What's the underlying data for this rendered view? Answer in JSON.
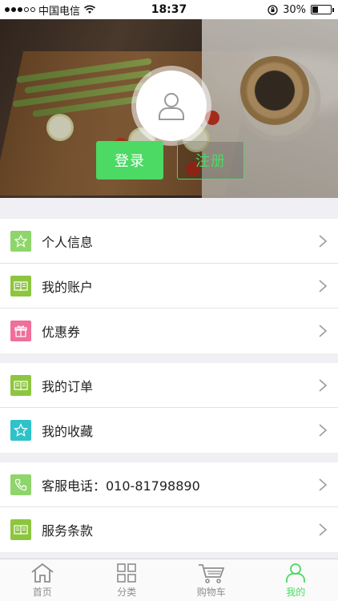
{
  "status_bar": {
    "carrier": "中国电信",
    "time": "18:37",
    "battery": "30%",
    "battery_level": 0.3
  },
  "header": {
    "login_label": "登录",
    "register_label": "注册"
  },
  "menu_groups": [
    {
      "items": [
        {
          "label": "个人信息",
          "icon": "profile-badge-icon",
          "color": "#8ed66b"
        },
        {
          "label": "我的账户",
          "icon": "book-icon",
          "color": "#8cc63f"
        },
        {
          "label": "优惠券",
          "icon": "gift-icon",
          "color": "#f06e9a"
        }
      ]
    },
    {
      "items": [
        {
          "label": "我的订单",
          "icon": "book-icon",
          "color": "#8cc63f"
        },
        {
          "label": "我的收藏",
          "icon": "star-icon",
          "color": "#2ec2c9"
        }
      ]
    },
    {
      "items": [
        {
          "label": "客服电话：010-81798890",
          "icon": "phone-icon",
          "color": "#8ed66b"
        },
        {
          "label": "服务条款",
          "icon": "book-icon",
          "color": "#8cc63f"
        }
      ]
    }
  ],
  "tabs": [
    {
      "label": "首页",
      "icon": "home-icon"
    },
    {
      "label": "分类",
      "icon": "grid-icon"
    },
    {
      "label": "购物车",
      "icon": "cart-icon"
    },
    {
      "label": "我的",
      "icon": "user-icon",
      "active": true
    }
  ],
  "colors": {
    "accent": "#4cd964",
    "background": "#efeff4"
  }
}
